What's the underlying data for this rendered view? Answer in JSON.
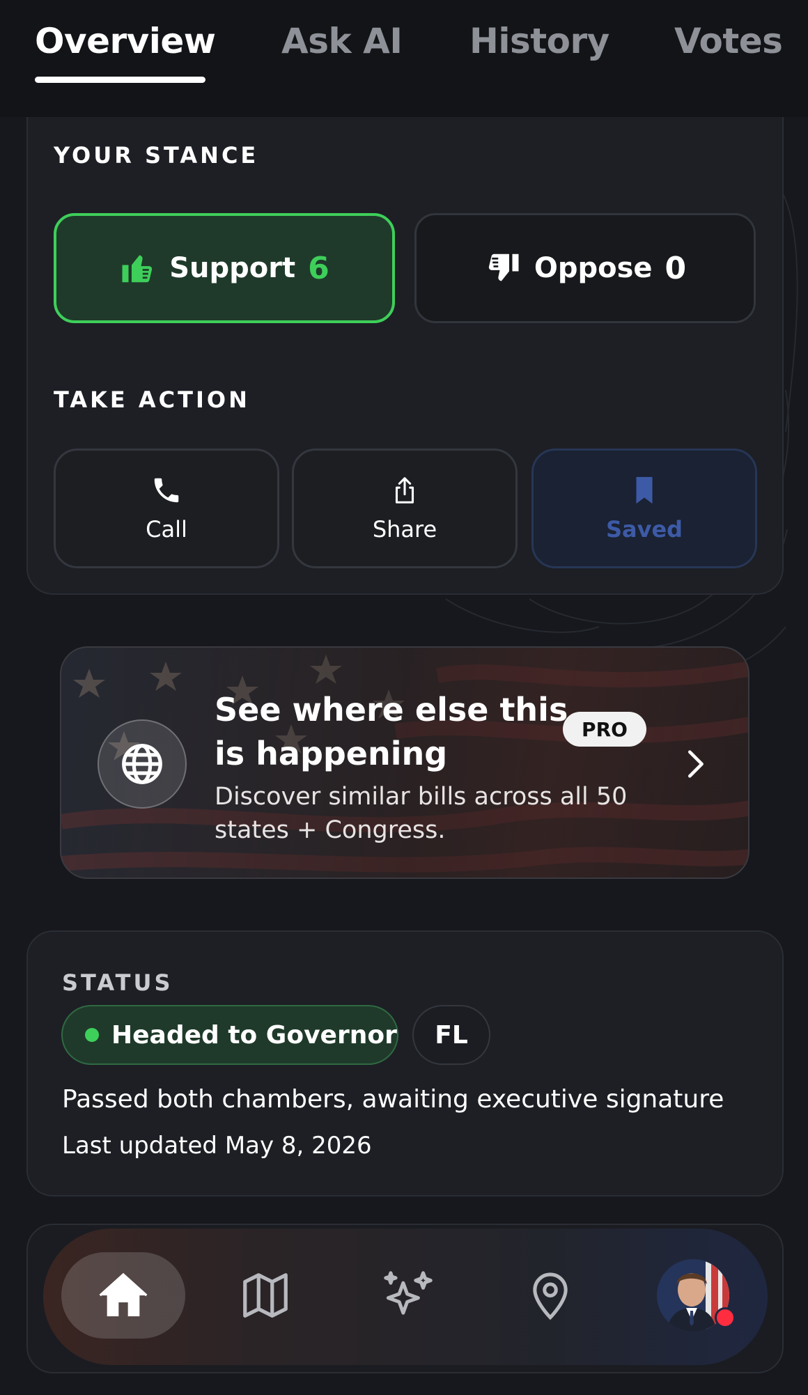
{
  "tabs": [
    {
      "label": "Overview",
      "active": true
    },
    {
      "label": "Ask AI",
      "active": false
    },
    {
      "label": "History",
      "active": false
    },
    {
      "label": "Votes",
      "active": false
    }
  ],
  "stance": {
    "section_label": "YOUR STANCE",
    "support_label": "Support",
    "support_count": "6",
    "support_icon": "thumbs-up-icon",
    "oppose_label": "Oppose",
    "oppose_count": "0",
    "oppose_icon": "thumbs-down-icon"
  },
  "actions": {
    "section_label": "TAKE ACTION",
    "call_label": "Call",
    "share_label": "Share",
    "saved_label": "Saved",
    "saved_color": "#3d5aa6"
  },
  "promo": {
    "title": "See where else this is happening",
    "badge": "PRO",
    "description": "Discover similar bills across all 50 states + Congress."
  },
  "status": {
    "section_label": "STATUS",
    "pill_label": "Headed to Governor",
    "state": "FL",
    "description": "Passed both chambers, awaiting executive signature",
    "last_updated": "Last updated May 8, 2026"
  },
  "colors": {
    "accent_green": "#3ecf5a",
    "background": "#16181d",
    "card": "#1d1f25",
    "notification_red": "#ff2d3f"
  },
  "nav": {
    "items": [
      "home-icon",
      "map-icon",
      "sparkles-icon",
      "location-pin-icon",
      "avatar"
    ]
  }
}
